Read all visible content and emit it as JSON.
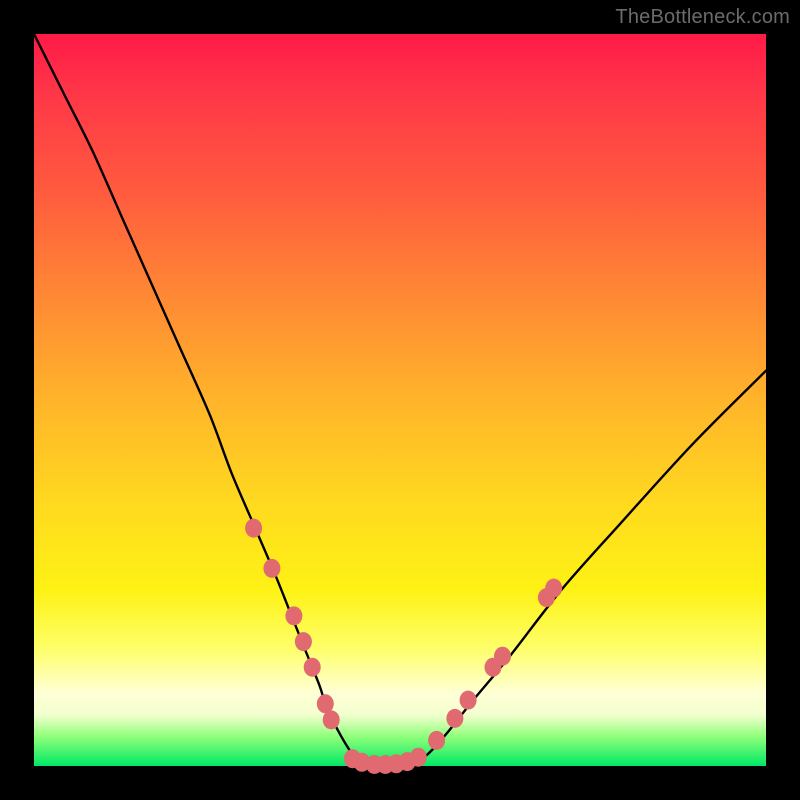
{
  "watermark": "TheBottleneck.com",
  "colors": {
    "page_bg": "#000000",
    "gradient_top": "#ff1a47",
    "gradient_mid1": "#ff8934",
    "gradient_mid2": "#ffd91f",
    "gradient_mid3": "#feff6a",
    "gradient_bottom": "#00e865",
    "curve_stroke": "#000000",
    "marker_fill": "#e06a6f",
    "marker_stroke": "#c24b52",
    "watermark_text": "#6b6b6b"
  },
  "chart_data": {
    "type": "line",
    "title": "",
    "xlabel": "",
    "ylabel": "",
    "xlim": [
      0,
      100
    ],
    "ylim": [
      0,
      100
    ],
    "grid": false,
    "legend": false,
    "series": [
      {
        "name": "bottleneck-curve",
        "x": [
          0,
          4,
          8,
          12,
          16,
          20,
          24,
          27,
          30,
          33,
          35,
          37,
          39,
          40,
          42,
          44,
          46,
          48,
          50,
          53,
          56,
          60,
          65,
          72,
          80,
          90,
          100
        ],
        "y": [
          100,
          92,
          84,
          75,
          66,
          57,
          48,
          40,
          33,
          26,
          21,
          16,
          11,
          8,
          4,
          1,
          0,
          0,
          0,
          1,
          4,
          9,
          15,
          24,
          33,
          44,
          54
        ]
      }
    ],
    "markers": [
      {
        "name": "left-marker-1",
        "x": 30.0,
        "y": 32.5
      },
      {
        "name": "left-marker-2",
        "x": 32.5,
        "y": 27.0
      },
      {
        "name": "left-marker-3",
        "x": 35.5,
        "y": 20.5
      },
      {
        "name": "left-marker-4",
        "x": 36.8,
        "y": 17.0
      },
      {
        "name": "left-marker-5",
        "x": 38.0,
        "y": 13.5
      },
      {
        "name": "left-marker-6",
        "x": 39.8,
        "y": 8.5
      },
      {
        "name": "left-marker-7",
        "x": 40.6,
        "y": 6.3
      },
      {
        "name": "bottom-marker-1",
        "x": 43.5,
        "y": 1.0
      },
      {
        "name": "bottom-marker-2",
        "x": 44.8,
        "y": 0.5
      },
      {
        "name": "bottom-marker-3",
        "x": 46.5,
        "y": 0.2
      },
      {
        "name": "bottom-marker-4",
        "x": 48.0,
        "y": 0.2
      },
      {
        "name": "bottom-marker-5",
        "x": 49.5,
        "y": 0.3
      },
      {
        "name": "bottom-marker-6",
        "x": 51.0,
        "y": 0.6
      },
      {
        "name": "bottom-marker-7",
        "x": 52.5,
        "y": 1.2
      },
      {
        "name": "right-marker-1",
        "x": 55.0,
        "y": 3.5
      },
      {
        "name": "right-marker-2",
        "x": 57.5,
        "y": 6.5
      },
      {
        "name": "right-marker-3",
        "x": 59.3,
        "y": 9.0
      },
      {
        "name": "right-marker-4",
        "x": 62.7,
        "y": 13.5
      },
      {
        "name": "right-marker-5",
        "x": 64.0,
        "y": 15.0
      },
      {
        "name": "right-marker-6",
        "x": 70.0,
        "y": 23.0
      },
      {
        "name": "right-marker-7",
        "x": 71.0,
        "y": 24.3
      }
    ]
  }
}
